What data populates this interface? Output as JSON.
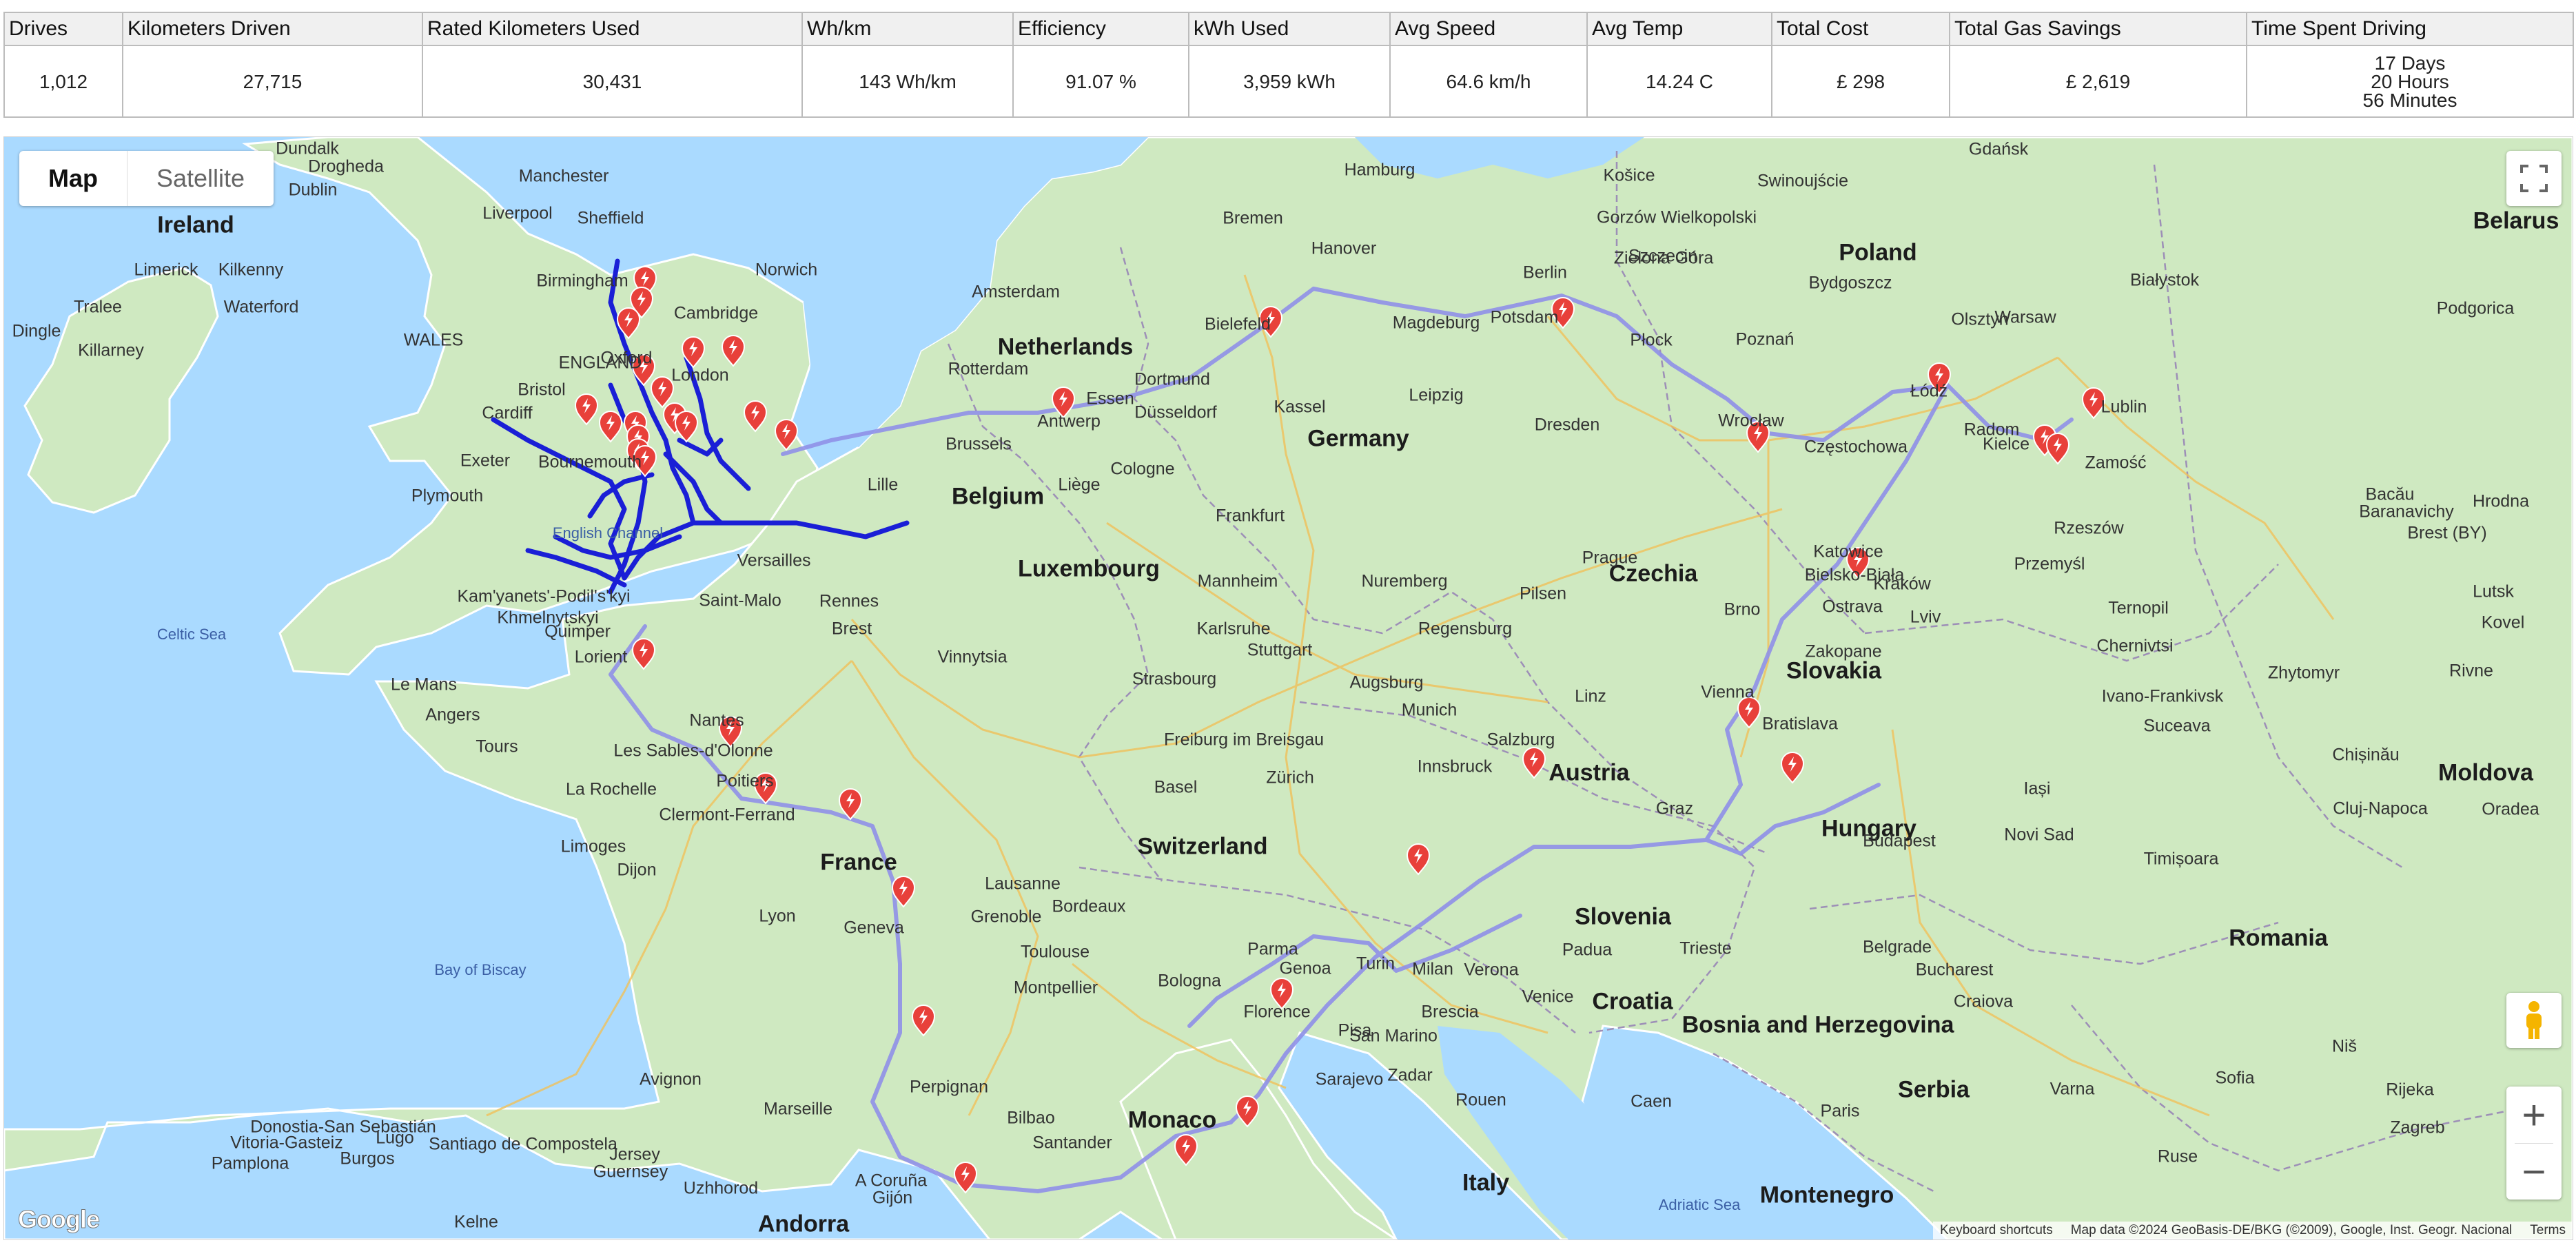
{
  "stats": {
    "headers": [
      "Drives",
      "Kilometers Driven",
      "Rated Kilometers Used",
      "Wh/km",
      "Efficiency",
      "kWh Used",
      "Avg Speed",
      "Avg Temp",
      "Total Cost",
      "Total Gas Savings",
      "Time Spent Driving"
    ],
    "values": [
      "1,012",
      "27,715",
      "30,431",
      "143 Wh/km",
      "91.07 %",
      "3,959 kWh",
      "64.6 km/h",
      "14.24 C",
      "£ 298",
      "£ 2,619"
    ],
    "time_lines": [
      "17 Days",
      "20 Hours",
      "56 Minutes"
    ]
  },
  "map": {
    "type_map": "Map",
    "type_satellite": "Satellite",
    "fullscreen_icon": "fullscreen-icon",
    "pegman_icon": "pegman-icon",
    "zoom_in": "+",
    "zoom_out": "−",
    "logo": "Google",
    "footer": {
      "shortcuts": "Keyboard shortcuts",
      "data": "Map data ©2024 GeoBasis-DE/BKG (©2009), Google, Inst. Geogr. Nacional",
      "terms": "Terms"
    },
    "colors": {
      "water": "#aadaff",
      "land": "#cfe9c1",
      "route_dense": "#1a1fd6",
      "route_faint": "#8f90e8",
      "marker": "#e8403a"
    },
    "countries": [
      "Ireland",
      "Poland",
      "Belarus",
      "Netherlands",
      "Germany",
      "Belgium",
      "Luxembourg",
      "Czechia",
      "Slovakia",
      "Austria",
      "Hungary",
      "Moldova",
      "Switzerland",
      "France",
      "Slovenia",
      "Croatia",
      "Romania",
      "Bosnia and Herzegovina",
      "Serbia",
      "Monaco",
      "Italy",
      "Montenegro",
      "Andorra",
      "WALES",
      "ENGLAND"
    ],
    "cities": [
      "Dundalk",
      "Drogheda",
      "Dublin",
      "Manchester",
      "Sheffield",
      "Liverpool",
      "Birmingham",
      "Norwich",
      "Cambridge",
      "Oxford",
      "London",
      "Bristol",
      "Cardiff",
      "Exeter",
      "Plymouth",
      "Bournemouth",
      "Limerick",
      "Kilkenny",
      "Tralee",
      "Waterford",
      "Dingle",
      "Killarney",
      "Hamburg",
      "Bremen",
      "Hanover",
      "Berlin",
      "Potsdam",
      "Magdeburg",
      "Bielefeld",
      "Amsterdam",
      "Rotterdam",
      "Essen",
      "Dortmund",
      "Düsseldorf",
      "Antwerp",
      "Brussels",
      "Kassel",
      "Leipzig",
      "Dresden",
      "Cologne",
      "Liège",
      "Lille",
      "Frankfurt",
      "Mannheim",
      "Nuremberg",
      "Karlsruhe",
      "Stuttgart",
      "Regensburg",
      "Strasbourg",
      "Augsburg",
      "Munich",
      "Freiburg im Breisgau",
      "Salzburg",
      "Innsbruck",
      "Zürich",
      "Basel",
      "Linz",
      "Vienna",
      "Bratislava",
      "Graz",
      "Budapest",
      "Brno",
      "Ostrava",
      "Katowice",
      "Kraków",
      "Bielsko-Biała",
      "Prague",
      "Pilsen",
      "Częstochowa",
      "Wrocław",
      "Łódź",
      "Radom",
      "Kielce",
      "Warsaw",
      "Lublin",
      "Zamość",
      "Rzeszów",
      "Przemyśl",
      "Białystok",
      "Bydgoszcz",
      "Poznań",
      "Szczecin",
      "Gorzów Wielkopolski",
      "Zielona Góra",
      "Płock",
      "Olsztyn",
      "Gdańsk",
      "Swinoujście",
      "Košice",
      "Zakopane",
      "Lviv",
      "Ternopil",
      "Ivano-Frankivsk",
      "Chernivtsi",
      "Suceava",
      "Iași",
      "Chișinău",
      "Cluj-Napoca",
      "Oradea",
      "Timișoara",
      "Novi Sad",
      "Belgrade",
      "Bucharest",
      "Craiova",
      "Niš",
      "Sofia",
      "Varna",
      "Ruse",
      "Zagreb",
      "Rijeka",
      "Trieste",
      "Venice",
      "Padua",
      "Verona",
      "Brescia",
      "Milan",
      "Turin",
      "Genoa",
      "Parma",
      "Bologna",
      "Florence",
      "Pisa",
      "San Marino",
      "Zadar",
      "Sarajevo",
      "Rouen",
      "Caen",
      "Paris",
      "Versailles",
      "Saint-Malo",
      "Rennes",
      "Brest",
      "Quimper",
      "Lorient",
      "Le Mans",
      "Angers",
      "Tours",
      "Nantes",
      "Les Sables-d'Olonne",
      "Poitiers",
      "La Rochelle",
      "Limoges",
      "Clermont-Ferrand",
      "Dijon",
      "Lyon",
      "Geneva",
      "Lausanne",
      "Grenoble",
      "Bordeaux",
      "Toulouse",
      "Montpellier",
      "Avignon",
      "Marseille",
      "Perpignan",
      "Bilbao",
      "Santander",
      "A Coruña",
      "Gijón",
      "Lugo",
      "Santiago de Compostela",
      "Vitoria-Gasteiz",
      "Donostia-San Sebastián",
      "Burgos",
      "Pamplona",
      "Guernsey",
      "Jersey",
      "Kelne",
      "Uzhhorod",
      "Kam'yanets'-Podil's'kyi",
      "Khmelnytskyi",
      "Vinnytsia",
      "Zhytomyr",
      "Rivne",
      "Lutsk",
      "Kovel",
      "Hrodna",
      "Brest (BY)",
      "Baranavichy",
      "Bacău",
      "Podgorica"
    ],
    "seas": [
      "Celtic Sea",
      "English Channel",
      "Bay of Biscay",
      "Adriatic Sea"
    ],
    "charger_count": 40
  }
}
